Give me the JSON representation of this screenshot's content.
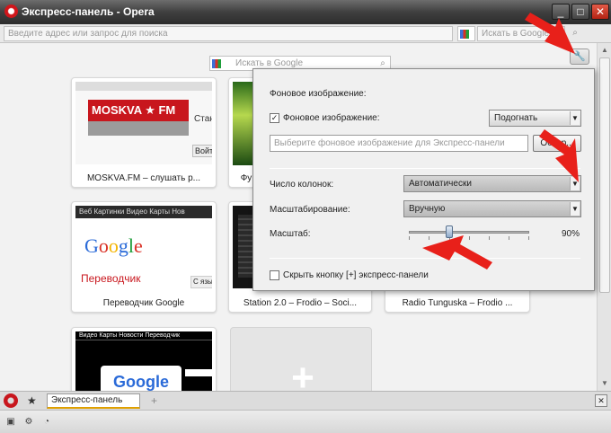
{
  "window": {
    "title": "Экспресс-панель - Opera",
    "minimize": "_",
    "maximize": "□",
    "close": "✕"
  },
  "addressbar": {
    "placeholder": "Введите адрес или запрос для поиска",
    "search_placeholder": "Искать в Google",
    "search_button": "⌕"
  },
  "speeddial": {
    "search_placeholder": "Искать в Google",
    "tiles": [
      {
        "caption": "MOSKVA.FM – слушать р...",
        "thumb_logo": "MOSKVA ★ FM",
        "thumb_side": "Стан",
        "thumb_btn": "Войт"
      },
      {
        "caption": "Фу"
      },
      {
        "caption": "Переводчик Google",
        "thumb_nav": "Веб  Картинки  Видео  Карты  Нов",
        "thumb_logo": "Google",
        "thumb_bottom": "Переводчик",
        "thumb_btn": "С язы"
      },
      {
        "caption": "Station 2.0 – Frodio – Soci..."
      },
      {
        "caption": "Radio Tunguska – Frodio ..."
      },
      {
        "thumb_nav": "Видео  Карты  Новости  Переводчик",
        "thumb_logo": "Google"
      }
    ],
    "add_symbol": "+"
  },
  "settings": {
    "section_title": "Фоновое изображение:",
    "bg_checkbox_label": "Фоновое изображение:",
    "bg_checkbox_checked": true,
    "fit_value": "Подогнать",
    "bg_input_placeholder": "Выберите фоновое изображение для Экспресс-панели",
    "browse_label": "Обзор...",
    "columns_label": "Число колонок:",
    "columns_value": "Автоматически",
    "scaling_label": "Масштабирование:",
    "scaling_value": "Вручную",
    "scale_label": "Масштаб:",
    "scale_value": "90%",
    "scale_level": 0.35,
    "hide_button_label": "Скрыть кнопку [+] экспресс-панели",
    "hide_button_checked": false
  },
  "tabbar": {
    "tab_label": "Экспресс-панель",
    "new_tab": "+",
    "close_all": "✕"
  },
  "colors": {
    "arrow": "#e8201a",
    "tab_accent": "#e0a000",
    "opera_red": "#c8161d"
  }
}
